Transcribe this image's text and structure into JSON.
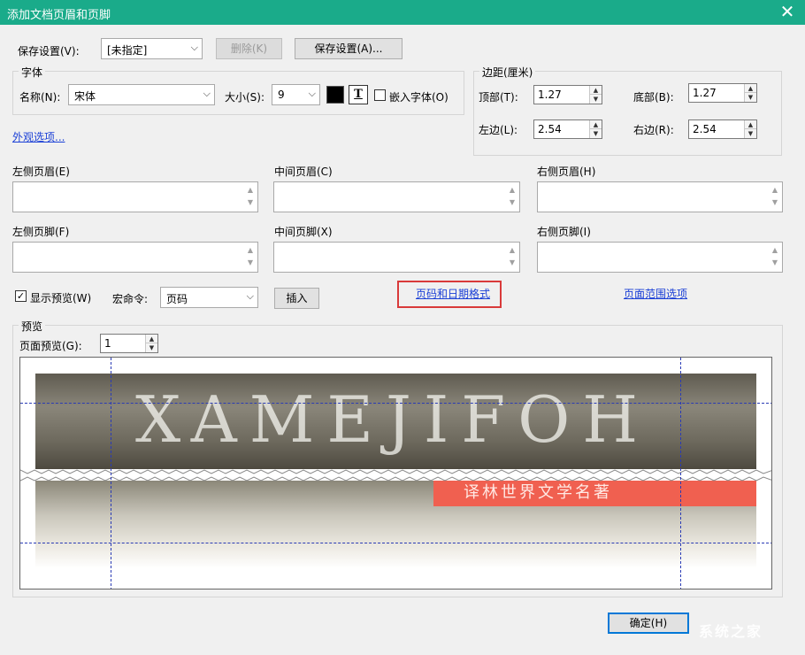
{
  "window": {
    "title": "添加文档页眉和页脚",
    "close_symbol": "✕"
  },
  "saved_settings": {
    "label": "保存设置(V):",
    "value": "[未指定]",
    "delete_button": "删除(K)",
    "save_button": "保存设置(A)..."
  },
  "font_group": {
    "title": "字体",
    "name_label": "名称(N):",
    "name_value": "宋体",
    "size_label": "大小(S):",
    "size_value": "9",
    "color": "#000000",
    "underline_glyph": "T",
    "embed_label": "嵌入字体(O)"
  },
  "margins": {
    "title": "边距(厘米)",
    "top_label": "顶部(T):",
    "top_value": "1.27",
    "bottom_label": "底部(B):",
    "bottom_value": "1.27",
    "left_label": "左边(L):",
    "left_value": "2.54",
    "right_label": "右边(R):",
    "right_value": "2.54"
  },
  "appearance_link": "外观选项...",
  "header_fields": {
    "left": "左侧页眉(E)",
    "center": "中间页眉(C)",
    "right": "右侧页眉(H)"
  },
  "footer_fields": {
    "left": "左侧页脚(F)",
    "center": "中间页脚(X)",
    "right": "右侧页脚(I)"
  },
  "options": {
    "show_preview_label": "显示预览(W)",
    "show_preview_checked": "✓",
    "macro_label": "宏命令:",
    "macro_value": "页码",
    "insert_button": "插入",
    "page_date_format_link": "页码和日期格式",
    "page_range_link": "页面范围选项"
  },
  "preview": {
    "title": "预览",
    "page_label": "页面预览(G):",
    "page_value": "1",
    "cover_title": "XAMEJIFOH",
    "cover_banner": "译林世界文学名著"
  },
  "footer": {
    "ok_button": "确定(H)",
    "watermark": "系统之家"
  },
  "colors": {
    "title_bar": "#1aab8a",
    "link": "#1a3fd6",
    "highlight": "#d93a3a",
    "guide": "#2a3bb5"
  }
}
